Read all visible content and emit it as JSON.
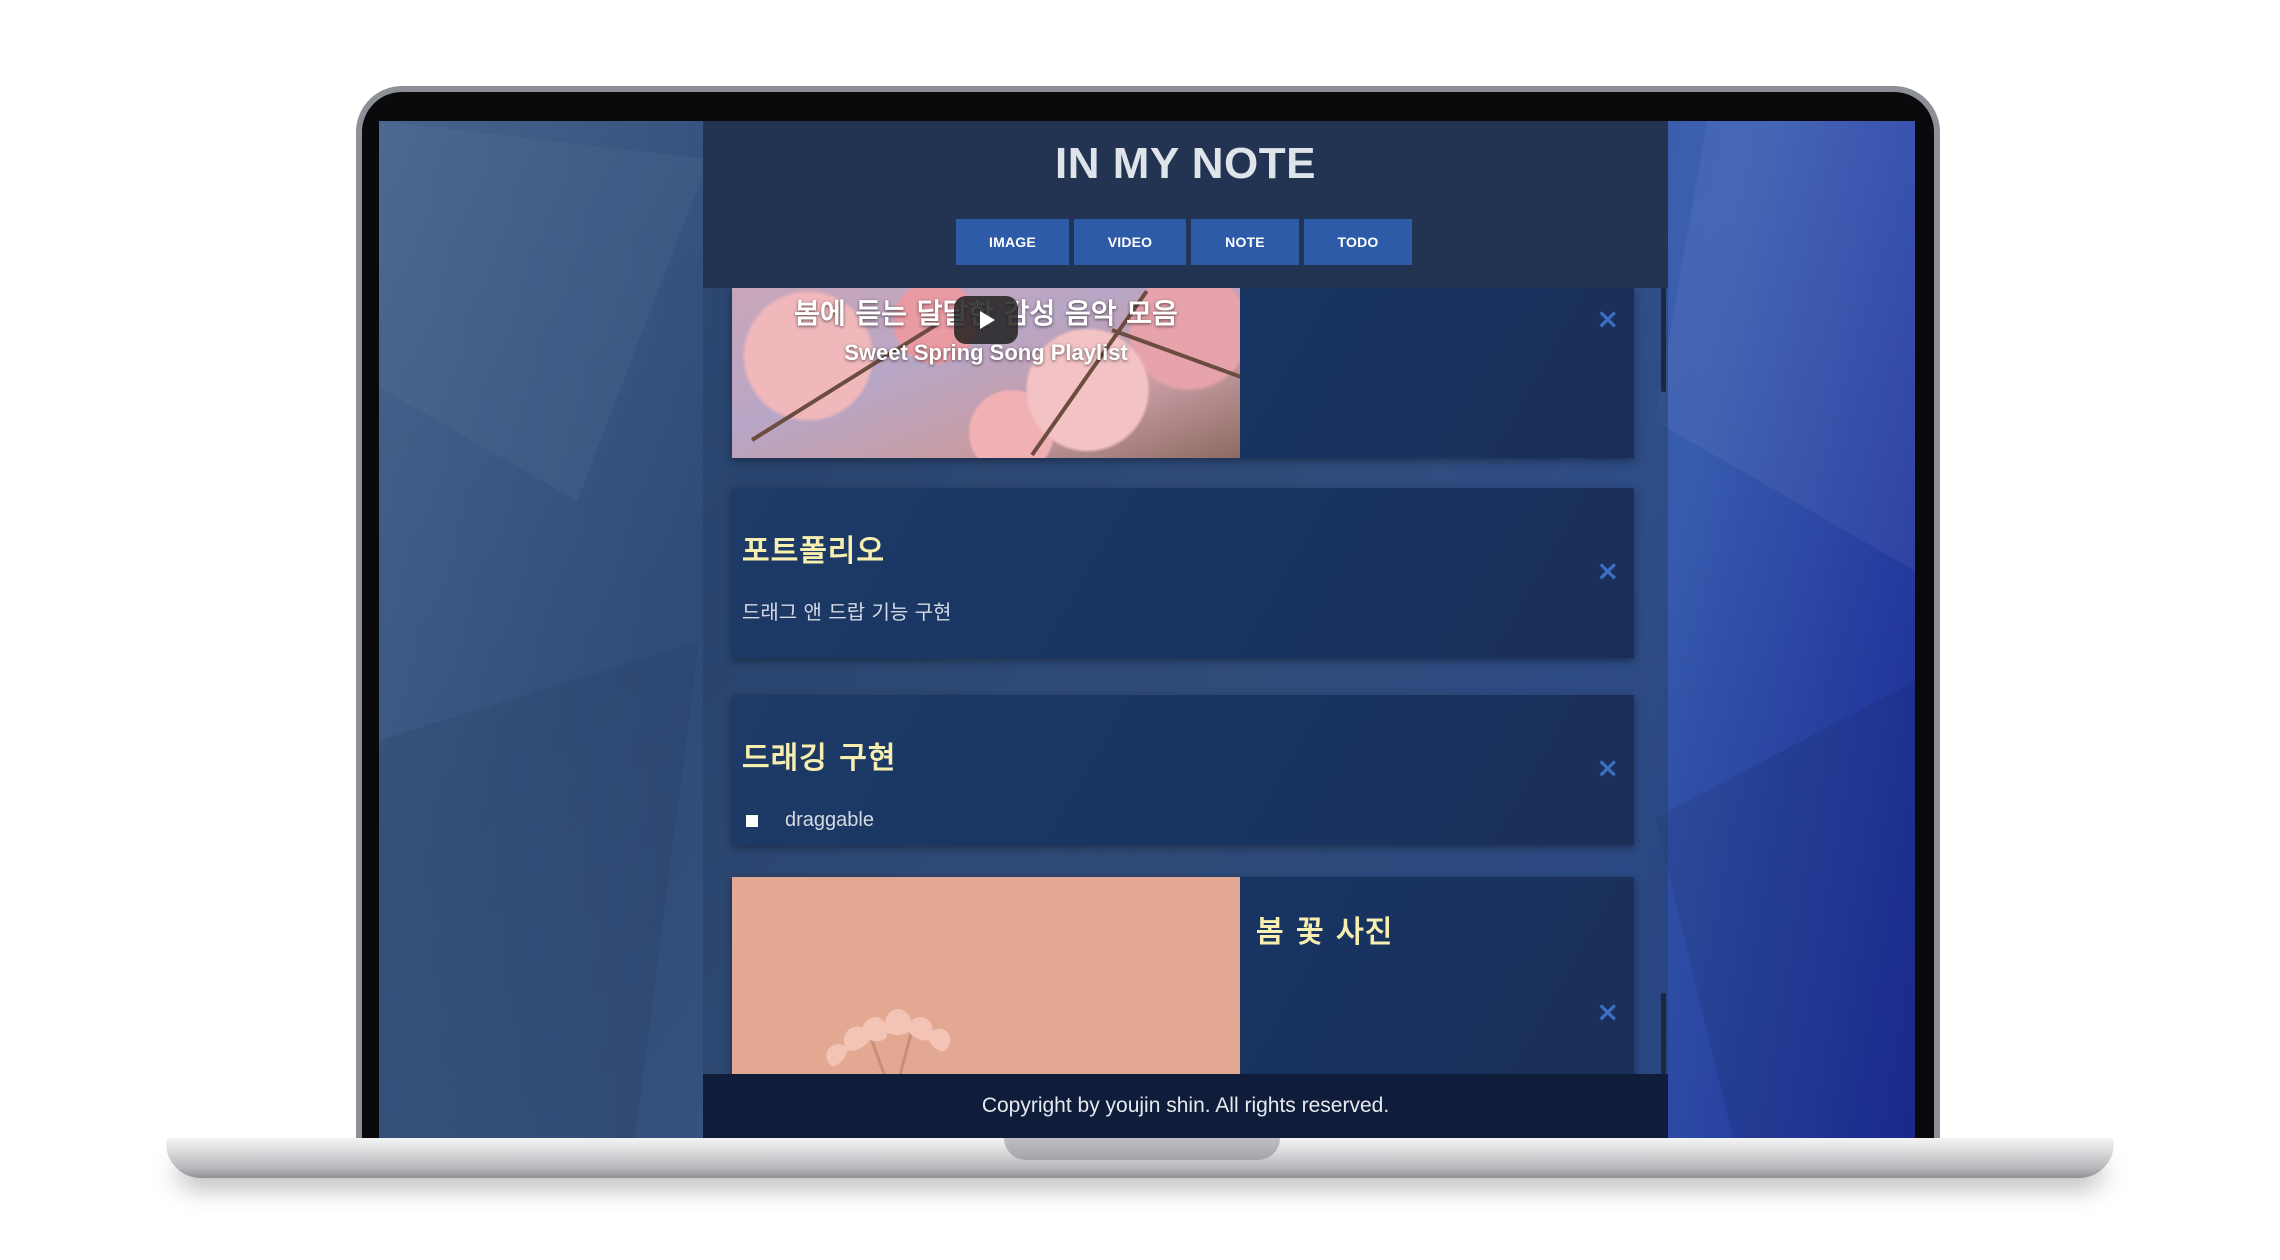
{
  "app": {
    "title": "IN MY NOTE"
  },
  "nav": {
    "items": [
      {
        "label": "IMAGE"
      },
      {
        "label": "VIDEO"
      },
      {
        "label": "NOTE"
      },
      {
        "label": "TODO"
      }
    ]
  },
  "cards": {
    "video": {
      "thumb_title_ko": "봄에 듣는 달달한 감성 음악 모음",
      "thumb_title_en": "Sweet Spring Song Playlist",
      "close": "×"
    },
    "note": {
      "title": "포트폴리오",
      "body": "드래그 앤 드랍 기능 구현",
      "close": "×"
    },
    "todo": {
      "title": "드래깅 구현",
      "item": "draggable",
      "close": "×"
    },
    "image": {
      "title": "봄 꽃 사진",
      "close": "×"
    }
  },
  "footer": {
    "text": "Copyright by youjin shin. All rights reserved."
  },
  "colors": {
    "header_bg": "#233452",
    "nav_button": "#2e5ba8",
    "card_title": "#f7efb0",
    "close_icon": "#3b6fc2",
    "footer_bg": "#101d3a"
  }
}
